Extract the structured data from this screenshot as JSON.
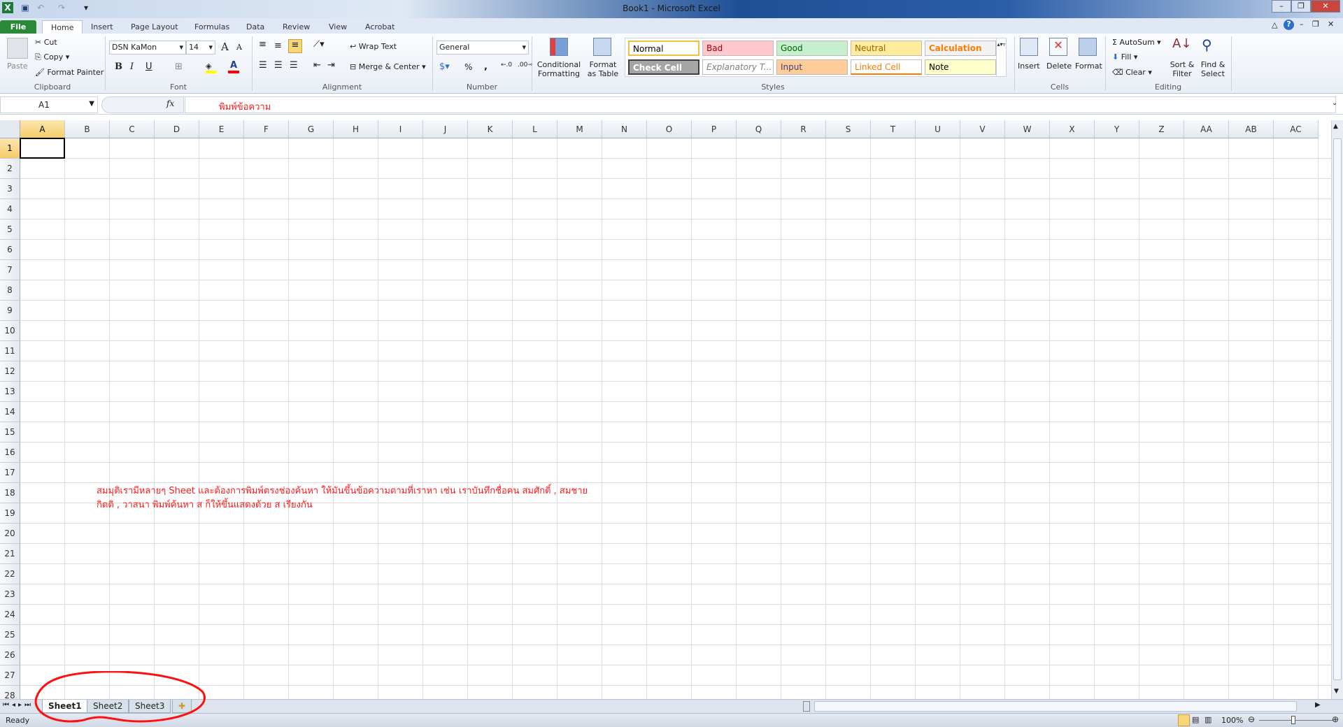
{
  "window": {
    "title": "Book1 - Microsoft Excel"
  },
  "tabs": [
    "File",
    "Home",
    "Insert",
    "Page Layout",
    "Formulas",
    "Data",
    "Review",
    "View",
    "Acrobat"
  ],
  "clipboard": {
    "paste": "Paste",
    "cut": "Cut",
    "copy": "Copy",
    "format_painter": "Format Painter",
    "label": "Clipboard"
  },
  "font": {
    "name": "DSN KaMon",
    "size": "14",
    "bold": "B",
    "italic": "I",
    "underline": "U",
    "label": "Font",
    "fill_color": "#ffff00",
    "font_color": "#ff0000"
  },
  "alignment": {
    "wrap": "Wrap Text",
    "merge": "Merge & Center",
    "label": "Alignment"
  },
  "number": {
    "format": "General",
    "percent": "%",
    "comma": ",",
    "label": "Number"
  },
  "styles": {
    "conditional": "Conditional Formatting",
    "format_table": "Format as Table",
    "label": "Styles",
    "cells": [
      {
        "t": "Normal",
        "bg": "#ffffff",
        "c": "#000000"
      },
      {
        "t": "Bad",
        "bg": "#ffc7ce",
        "c": "#9c0006"
      },
      {
        "t": "Good",
        "bg": "#c6efce",
        "c": "#006100"
      },
      {
        "t": "Neutral",
        "bg": "#ffeb9c",
        "c": "#9c6500"
      },
      {
        "t": "Calculation",
        "bg": "#f2f2f2",
        "c": "#fa7d00"
      },
      {
        "t": "Check Cell",
        "bg": "#a5a5a5",
        "c": "#ffffff"
      },
      {
        "t": "Explanatory T...",
        "bg": "#ffffff",
        "c": "#7f7f7f"
      },
      {
        "t": "Input",
        "bg": "#ffcc99",
        "c": "#3f3f76"
      },
      {
        "t": "Linked Cell",
        "bg": "#ffffff",
        "c": "#fa7d00"
      },
      {
        "t": "Note",
        "bg": "#ffffcc",
        "c": "#000000"
      }
    ]
  },
  "cells_group": {
    "insert": "Insert",
    "delete": "Delete",
    "format": "Format",
    "label": "Cells"
  },
  "editing": {
    "autosum": "AutoSum",
    "fill": "Fill",
    "clear": "Clear",
    "sort": "Sort & Filter",
    "find": "Find & Select",
    "label": "Editing"
  },
  "formula_bar": {
    "name_box": "A1",
    "fx": "fx",
    "content": "พิมพ์ข้อความ"
  },
  "columns": [
    "A",
    "B",
    "C",
    "D",
    "E",
    "F",
    "G",
    "H",
    "I",
    "J",
    "K",
    "L",
    "M",
    "N",
    "O",
    "P",
    "Q",
    "R",
    "S",
    "T",
    "U",
    "V",
    "W",
    "X",
    "Y",
    "Z",
    "AA",
    "AB",
    "AC"
  ],
  "rows": [
    "1",
    "2",
    "3",
    "4",
    "5",
    "6",
    "7",
    "8",
    "9",
    "10",
    "11",
    "12",
    "13",
    "14",
    "15",
    "16",
    "17",
    "18",
    "19",
    "20",
    "21",
    "22",
    "23",
    "24",
    "25",
    "26",
    "27",
    "28"
  ],
  "note": {
    "line1": "สมมุติเรามีหลายๆ  Sheet  และต้องการพิมพ์ตรงช่องค้นหา  ให้มันขึ้นข้อความตามที่เราหา  เช่น เราบันทึกชื่อคน  สมศักดิ์ , สมชาย",
    "line2": "กิตติ , วาสนา      พิมพ์ค้นหา  ส  ก็ให้ขึ้นแสดงด้วย ส  เรียงกัน"
  },
  "sheets": [
    "Sheet1",
    "Sheet2",
    "Sheet3"
  ],
  "status": {
    "ready": "Ready",
    "zoom": "100%"
  }
}
